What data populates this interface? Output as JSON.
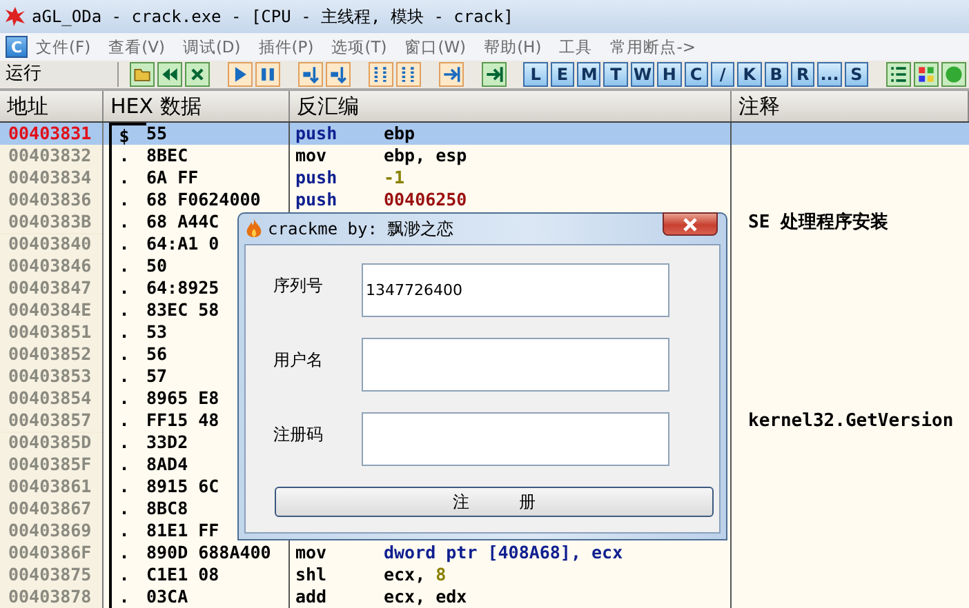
{
  "window": {
    "title": "aGL_ODa - crack.exe - [CPU -  主线程, 模块 - crack]"
  },
  "menu": {
    "app_button": "C",
    "items": [
      "文件(F)",
      "查看(V)",
      "调试(D)",
      "插件(P)",
      "选项(T)",
      "窗口(W)",
      "帮助(H)",
      "工具",
      "常用断点->"
    ]
  },
  "toolbar": {
    "status": "运行",
    "letter_buttons": [
      "L",
      "E",
      "M",
      "T",
      "W",
      "H",
      "C",
      "/",
      "K",
      "B",
      "R",
      "...",
      "S"
    ]
  },
  "columns": [
    "地址",
    "HEX 数据",
    "反汇编",
    "注释"
  ],
  "rows": [
    {
      "address": "00403831",
      "current": true,
      "selected": true,
      "block_start": true,
      "marker": "$",
      "hex": "55",
      "mnemonic": "push",
      "stack_op": true,
      "operands": [
        {
          "text": "ebp",
          "kind": "reg"
        }
      ]
    },
    {
      "address": "00403832",
      "current": false,
      "selected": false,
      "block_start": false,
      "marker": ".",
      "hex": "8BEC",
      "mnemonic": "mov",
      "stack_op": false,
      "operands": [
        {
          "text": "ebp, esp",
          "kind": "reg"
        }
      ]
    },
    {
      "address": "00403834",
      "current": false,
      "selected": false,
      "block_start": false,
      "marker": ".",
      "hex": "6A FF",
      "mnemonic": "push",
      "stack_op": true,
      "operands": [
        {
          "text": "-1",
          "kind": "imm"
        }
      ]
    },
    {
      "address": "00403836",
      "current": false,
      "selected": false,
      "block_start": false,
      "marker": ".",
      "hex": "68 F0624000",
      "mnemonic": "push",
      "stack_op": true,
      "operands": [
        {
          "text": "00406250",
          "kind": "addr"
        }
      ]
    },
    {
      "address": "0040383B",
      "current": false,
      "selected": false,
      "block_start": false,
      "marker": ".",
      "hex": "68 A44C",
      "comment": "SE 处理程序安装"
    },
    {
      "address": "00403840",
      "current": false,
      "selected": false,
      "block_start": false,
      "marker": ".",
      "hex": "64:A1 0"
    },
    {
      "address": "00403846",
      "current": false,
      "selected": false,
      "block_start": false,
      "marker": ".",
      "hex": "50"
    },
    {
      "address": "00403847",
      "current": false,
      "selected": false,
      "block_start": false,
      "marker": ".",
      "hex": "64:8925"
    },
    {
      "address": "0040384E",
      "current": false,
      "selected": false,
      "block_start": false,
      "marker": ".",
      "hex": "83EC 58"
    },
    {
      "address": "00403851",
      "current": false,
      "selected": false,
      "block_start": false,
      "marker": ".",
      "hex": "53"
    },
    {
      "address": "00403852",
      "current": false,
      "selected": false,
      "block_start": false,
      "marker": ".",
      "hex": "56"
    },
    {
      "address": "00403853",
      "current": false,
      "selected": false,
      "block_start": false,
      "marker": ".",
      "hex": "57"
    },
    {
      "address": "00403854",
      "current": false,
      "selected": false,
      "block_start": false,
      "marker": ".",
      "hex": "8965 E8"
    },
    {
      "address": "00403857",
      "current": false,
      "selected": false,
      "block_start": false,
      "marker": ".",
      "hex": "FF15 48",
      "comment": "kernel32.GetVersion"
    },
    {
      "address": "0040385D",
      "current": false,
      "selected": false,
      "block_start": false,
      "marker": ".",
      "hex": "33D2"
    },
    {
      "address": "0040385F",
      "current": false,
      "selected": false,
      "block_start": false,
      "marker": ".",
      "hex": "8AD4"
    },
    {
      "address": "00403861",
      "current": false,
      "selected": false,
      "block_start": false,
      "marker": ".",
      "hex": "8915 6C"
    },
    {
      "address": "00403867",
      "current": false,
      "selected": false,
      "block_start": false,
      "marker": ".",
      "hex": "8BC8"
    },
    {
      "address": "00403869",
      "current": false,
      "selected": false,
      "block_start": false,
      "marker": ".",
      "hex": "81E1 FF"
    },
    {
      "address": "0040386F",
      "current": false,
      "selected": false,
      "block_start": false,
      "marker": ".",
      "hex": "890D 688A400",
      "mnemonic": "mov",
      "stack_op": false,
      "operands": [
        {
          "text": "dword ptr [408A68], ecx",
          "kind": "mem"
        }
      ]
    },
    {
      "address": "00403875",
      "current": false,
      "selected": false,
      "block_start": false,
      "marker": ".",
      "hex": "C1E1 08",
      "mnemonic": "shl",
      "stack_op": false,
      "operands": [
        {
          "text": "ecx, ",
          "kind": "reg"
        },
        {
          "text": "8",
          "kind": "imm"
        }
      ]
    },
    {
      "address": "00403878",
      "current": false,
      "selected": false,
      "block_start": false,
      "marker": ".",
      "hex": "03CA",
      "mnemonic": "add",
      "stack_op": false,
      "operands": [
        {
          "text": "ecx, edx",
          "kind": "reg"
        }
      ]
    }
  ],
  "dialog": {
    "title": "crackme by: 飘渺之恋",
    "fields": [
      {
        "label": "序列号",
        "value": "1347726400"
      },
      {
        "label": "用户名"
      },
      {
        "label": "注册码"
      }
    ],
    "button": "注　　　册"
  }
}
